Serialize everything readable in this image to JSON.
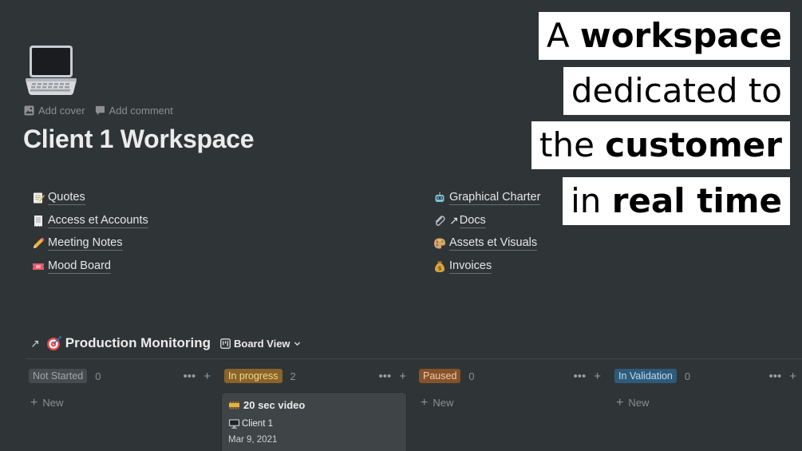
{
  "page": {
    "add_cover": "Add cover",
    "add_comment": "Add comment",
    "title": "Client 1 Workspace"
  },
  "links_left": [
    {
      "icon": "memo-icon",
      "label": "Quotes"
    },
    {
      "icon": "receipt-icon",
      "label": "Access et Accounts"
    },
    {
      "icon": "pencil-icon",
      "label": "Meeting Notes"
    },
    {
      "icon": "ticket-icon",
      "label": "Mood Board"
    }
  ],
  "links_right": [
    {
      "icon": "robot-icon",
      "label": "Graphical Charter"
    },
    {
      "icon": "paperclip-icon",
      "label": "Docs",
      "prefix": "↗"
    },
    {
      "icon": "palette-icon",
      "label": "Assets et Visuals"
    },
    {
      "icon": "money-bag-icon",
      "label": "Invoices"
    }
  ],
  "overlay": {
    "line1_plain": "A ",
    "line1_bold": "workspace",
    "line2_plain": "dedicated to",
    "line3_plain": "the ",
    "line3_bold": "customer",
    "line4_plain": "in ",
    "line4_bold": "real time"
  },
  "database": {
    "arrow": "↗",
    "title": "Production Monitoring",
    "view_label": "Board View"
  },
  "board": {
    "new_label": "New",
    "columns": [
      {
        "name": "Not Started",
        "count": "0",
        "bg": "#454b4e",
        "fg": "#a3a6a8"
      },
      {
        "name": "In progress",
        "count": "2",
        "bg": "#89632a",
        "fg": "#f2d98a"
      },
      {
        "name": "Paused",
        "count": "0",
        "bg": "#85522b",
        "fg": "#f5c9a4"
      },
      {
        "name": "In Validation",
        "count": "0",
        "bg": "#2f5b7a",
        "fg": "#bcdcf2"
      }
    ],
    "card": {
      "title": "20 sec video",
      "client": "Client 1",
      "date": "Mar 9, 2021"
    }
  },
  "colors": {
    "background": "#2f3437",
    "card": "#3f4447",
    "muted_text": "#8d8f91"
  }
}
